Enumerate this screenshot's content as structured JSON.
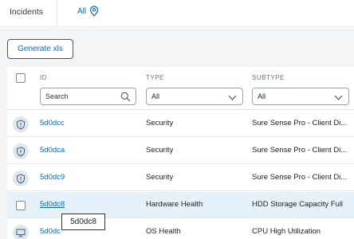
{
  "topbar": {
    "title": "Incidents",
    "filter_label": "All"
  },
  "toolbar": {
    "generate_label": "Generate xls"
  },
  "table": {
    "columns": {
      "id": "ID",
      "type": "TYPE",
      "subtype": "SUBTYPE"
    },
    "filters": {
      "search_placeholder": "Search",
      "type_value": "All",
      "subtype_value": "All"
    },
    "rows": [
      {
        "id": "5d0dcc",
        "type": "Security",
        "subtype": "Sure Sense Pro - Client Di...",
        "icon": "shield-icon"
      },
      {
        "id": "5d0dca",
        "type": "Security",
        "subtype": "Sure Sense Pro - Client Di...",
        "icon": "shield-icon"
      },
      {
        "id": "5d0dc9",
        "type": "Security",
        "subtype": "Sure Sense Pro - Client Di...",
        "icon": "shield-icon"
      },
      {
        "id": "5d0dc8",
        "type": "Hardware Health",
        "subtype": "HDD Storage Capacity Full",
        "icon": "checkbox"
      },
      {
        "id": "5d0dc",
        "type": "OS Health",
        "subtype": "CPU High Utilization",
        "icon": "monitor-icon"
      }
    ]
  },
  "tooltip": {
    "text": "5d0dc8"
  },
  "colors": {
    "accent": "#0b69ad",
    "row_highlight": "#e6f1f9",
    "background": "#f2f4f6"
  }
}
